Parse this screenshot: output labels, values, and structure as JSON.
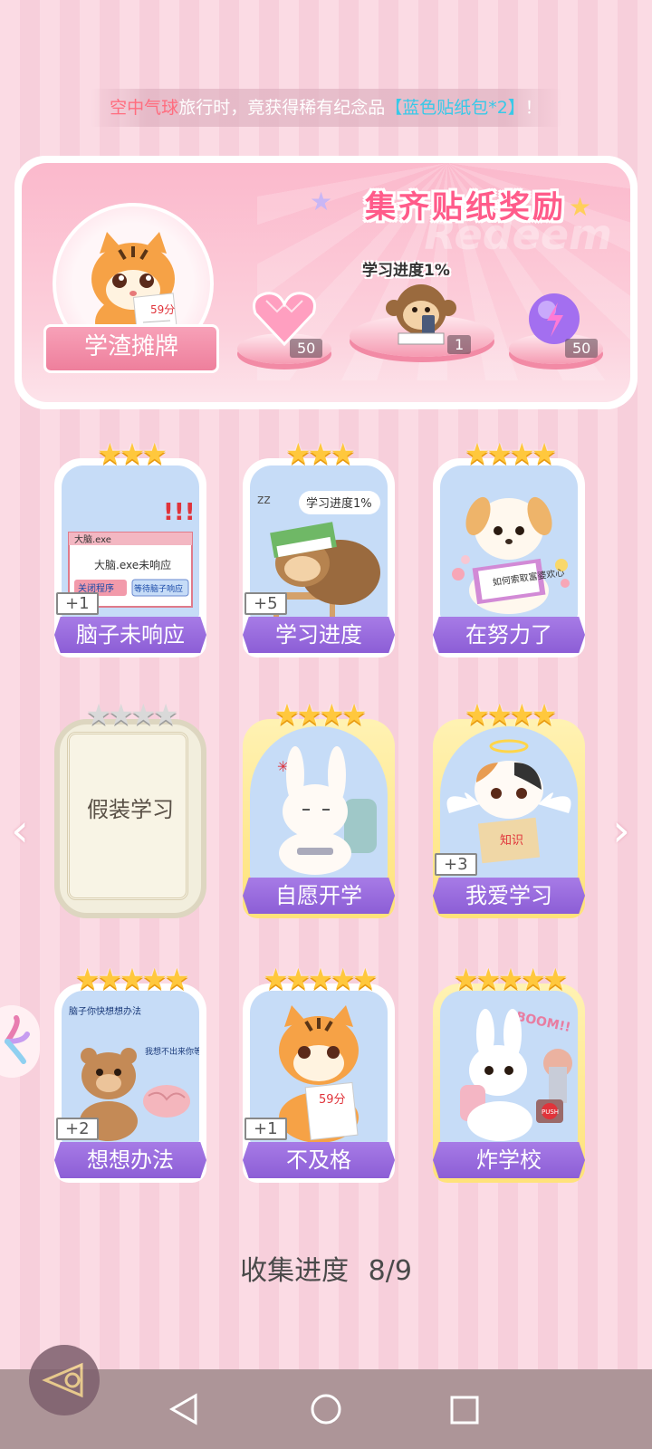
{
  "ticker": {
    "prefix": "空中气球",
    "middle": "旅行时，竟获得稀有纪念品",
    "item": "【蓝色贴纸包*2】",
    "suffix": "！"
  },
  "banner": {
    "title": "集齐贴纸奖励",
    "watermark": "Redeem",
    "avatar_name": "学渣摊牌",
    "avatar_paper": "59分",
    "progress_label": "学习进度1%",
    "rewards": [
      {
        "name": "heart-gem",
        "count": "50"
      },
      {
        "name": "monkey-sticker",
        "count": "1"
      },
      {
        "name": "lightning-orb",
        "count": "50"
      }
    ]
  },
  "cards": [
    {
      "name": "脑子未响应",
      "stars": "★★★",
      "bonus": "+1",
      "window_title": "大脑.exe",
      "window_msg": "大脑.exe未响应",
      "btn1": "关闭程序",
      "btn2": "等待脑子响应"
    },
    {
      "name": "学习进度",
      "stars": "★★★",
      "bonus": "+5",
      "caption": "学习进度1%"
    },
    {
      "name": "在努力了",
      "stars": "★★★★",
      "book": "如何索取富婆欢心"
    },
    {
      "name": "假装学习",
      "stars": "★★★★",
      "locked": true
    },
    {
      "name": "自愿开学",
      "stars": "★★★★"
    },
    {
      "name": "我爱学习",
      "stars": "★★★★",
      "bonus": "+3",
      "book": "知识"
    },
    {
      "name": "想想办法",
      "stars": "★★★★★",
      "bonus": "+2",
      "bubble1": "脑子你快想想办法",
      "bubble2": "我想不出来你等死吧"
    },
    {
      "name": "不及格",
      "stars": "★★★★★",
      "bonus": "+1",
      "paper": "59分"
    },
    {
      "name": "炸学校",
      "stars": "★★★★★",
      "boom": "BOOM!!",
      "push": "PUSH"
    }
  ],
  "collection": {
    "label": "收集进度",
    "value": "8/9"
  },
  "colors": {
    "accent_purple": "#8c5ed6",
    "accent_pink": "#ff5b8a",
    "gold_star": "#ffc83d"
  }
}
